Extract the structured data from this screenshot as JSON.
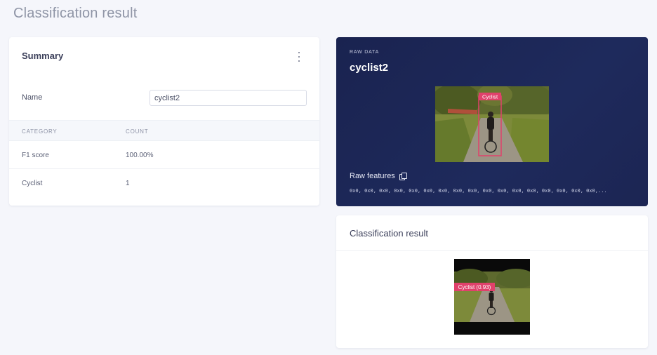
{
  "page": {
    "title": "Classification result"
  },
  "summary": {
    "title": "Summary",
    "name_label": "Name",
    "name_value": "cyclist2",
    "columns": [
      "CATEGORY",
      "COUNT"
    ],
    "rows": [
      {
        "category": "F1 score",
        "count": "100.00%"
      },
      {
        "category": "Cyclist",
        "count": "1"
      }
    ]
  },
  "raw": {
    "label": "RAW DATA",
    "title": "cyclist2",
    "bbox_label": "Cyclist",
    "features_label": "Raw features",
    "features_values": "0x0, 0x0, 0x0, 0x0, 0x0, 0x0, 0x0, 0x0, 0x0, 0x0, 0x0, 0x0, 0x0, 0x0, 0x0, 0x0, 0x0,..."
  },
  "result": {
    "title": "Classification result",
    "bbox_label": "Cyclist (0.93)"
  },
  "colors": {
    "accent_pink": "#e0416b",
    "raw_card_bg": "#1c2553"
  }
}
